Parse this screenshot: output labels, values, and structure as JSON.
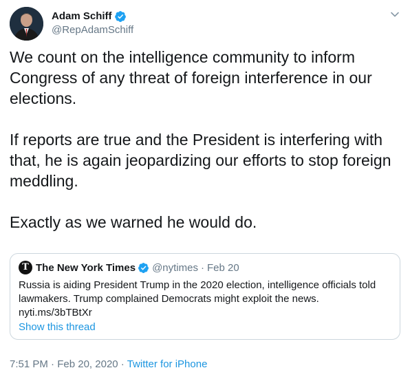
{
  "author": {
    "display_name": "Adam Schiff",
    "handle": "@RepAdamSchiff",
    "avatar_icon": "avatar-photo",
    "verified_icon": "verified-badge-icon"
  },
  "menu_icon": "chevron-down-icon",
  "tweet": {
    "paragraphs": [
      "We count on the intelligence community to inform Congress of any threat of foreign interference in our elections.",
      "If reports are true and the President is interfering with that, he is again jeopardizing our efforts to stop foreign meddling.",
      "Exactly as we warned he would do."
    ]
  },
  "quote": {
    "display_name": "The New York Times",
    "handle": "@nytimes",
    "separator": "·",
    "date": "Feb 20",
    "text": "Russia is aiding President Trump in the 2020 election, intelligence officials told lawmakers. Trump complained Democrats might exploit the news.",
    "link": "nyti.ms/3bTBtXr",
    "show_thread": "Show this thread",
    "logo_glyph": "T"
  },
  "meta": {
    "time": "7:51 PM",
    "separator": "·",
    "date": "Feb 20, 2020",
    "source": "Twitter for iPhone"
  },
  "colors": {
    "text": "#14171a",
    "secondary": "#657786",
    "link": "#1b95e0",
    "verified": "#1da1f2",
    "border": "#ccd6dd"
  }
}
